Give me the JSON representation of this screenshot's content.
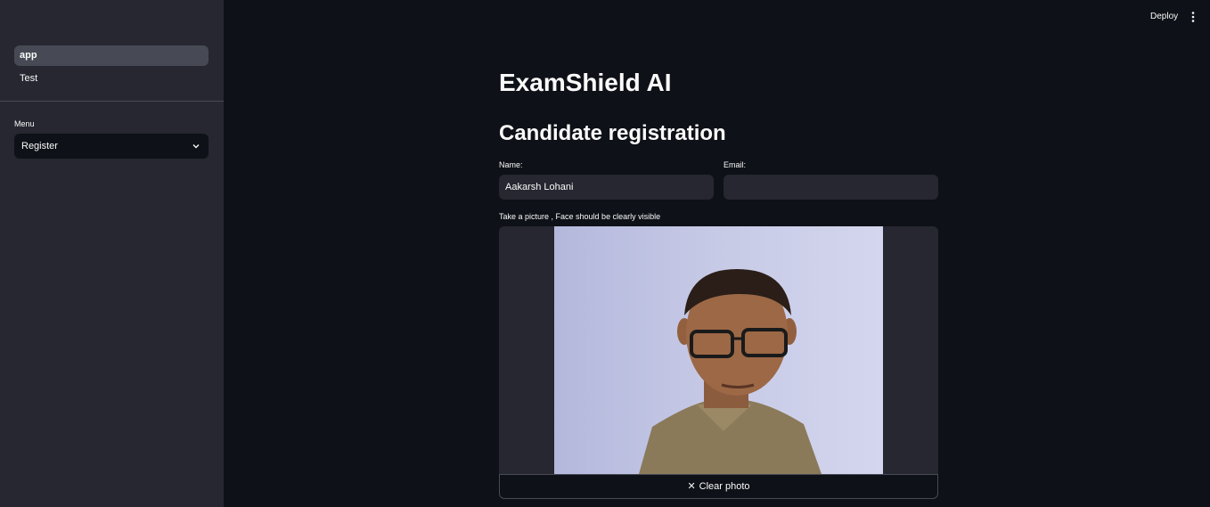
{
  "topbar": {
    "deploy_label": "Deploy",
    "more_icon": "kebab-menu-icon"
  },
  "sidebar": {
    "pages": [
      {
        "label": "app",
        "active": true
      },
      {
        "label": "Test",
        "active": false
      }
    ],
    "menu_label": "Menu",
    "menu_value": "Register",
    "menu_icon": "chevron-down-icon"
  },
  "main": {
    "title": "ExamShield AI",
    "subtitle": "Candidate registration",
    "name_label": "Name:",
    "name_value": "Aakarsh Lohani",
    "email_label": "Email:",
    "email_value": "",
    "camera_label": "Take a picture , Face should be clearly visible",
    "clear_label": "Clear photo",
    "clear_icon": "close-icon"
  },
  "colors": {
    "background": "#0e1117",
    "sidebar": "#262730",
    "input": "#262730",
    "text": "#fafafa"
  }
}
